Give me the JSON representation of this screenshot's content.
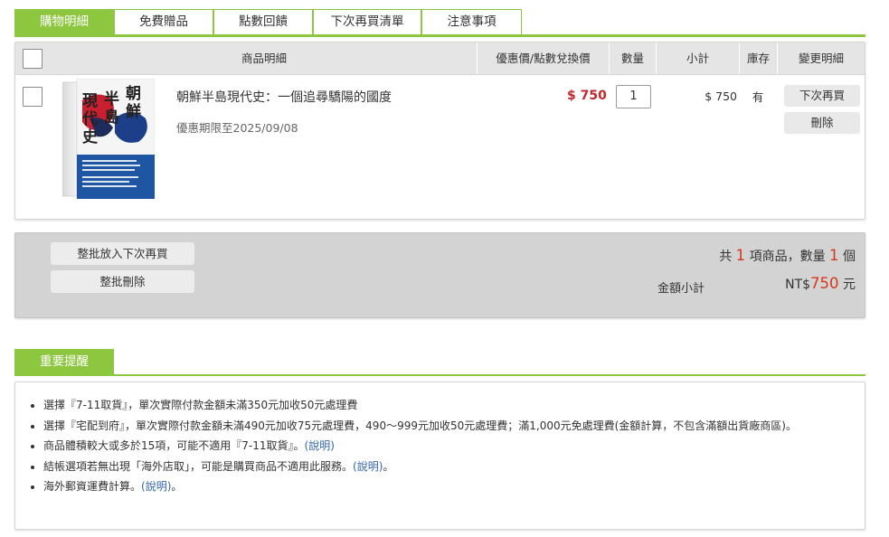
{
  "tabs": [
    {
      "label": "購物明細",
      "active": true
    },
    {
      "label": "免費贈品",
      "active": false
    },
    {
      "label": "點數回饋",
      "active": false
    },
    {
      "label": "下次再買清單",
      "active": false
    },
    {
      "label": "注意事項",
      "active": false
    }
  ],
  "table": {
    "headers": {
      "item": "商品明細",
      "price": "優惠價/點數兌換價",
      "qty": "數量",
      "subtotal": "小計",
      "stock": "庫存",
      "change": "變更明細"
    }
  },
  "item": {
    "title": "朝鮮半島現代史：一個追尋驕陽的國度",
    "period": "優惠期限至2025/09/08",
    "price": "$ 750",
    "quantity": "1",
    "subtotal": "$ 750",
    "stock": "有",
    "buy_later": "下次再買",
    "delete": "刪除",
    "cover": {
      "title_chars": [
        "朝",
        "鮮",
        "半",
        "島",
        "現",
        "代",
        "史"
      ]
    }
  },
  "summary": {
    "batch_later": "整批放入下次再買",
    "batch_delete": "整批刪除",
    "count_prefix": "共",
    "count_items": "1",
    "count_mid": "項商品，數量",
    "count_qty": "1",
    "count_suffix": "個",
    "amount_label": "金額小計",
    "amount_currency": "NT$",
    "amount_value": "750",
    "amount_unit": "元"
  },
  "notes": {
    "tab": "重要提醒",
    "items": [
      {
        "text": "選擇『7-11取貨』，單次實際付款金額未滿350元加收50元處理費",
        "link": ""
      },
      {
        "text": "選擇『宅配到府』，單次實際付款金額未滿490元加收75元處理費，490～999元加收50元處理費；滿1,000元免處理費(金額計算，不包含滿額出貨廠商區)。",
        "link": ""
      },
      {
        "text": "商品體積較大或多於15項，可能不適用『7-11取貨』。",
        "link": "(說明)"
      },
      {
        "text": "結帳選項若無出現「海外店取」，可能是購買商品不適用此服務。",
        "link": "(說明)",
        "tail": "。"
      },
      {
        "text": "海外郵資運費計算。",
        "link": "(說明)",
        "tail": "。"
      }
    ]
  },
  "colors": {
    "accent": "#8dc63f",
    "price_red": "#c1272d",
    "count_red": "#d2381c",
    "link": "#3366aa"
  }
}
